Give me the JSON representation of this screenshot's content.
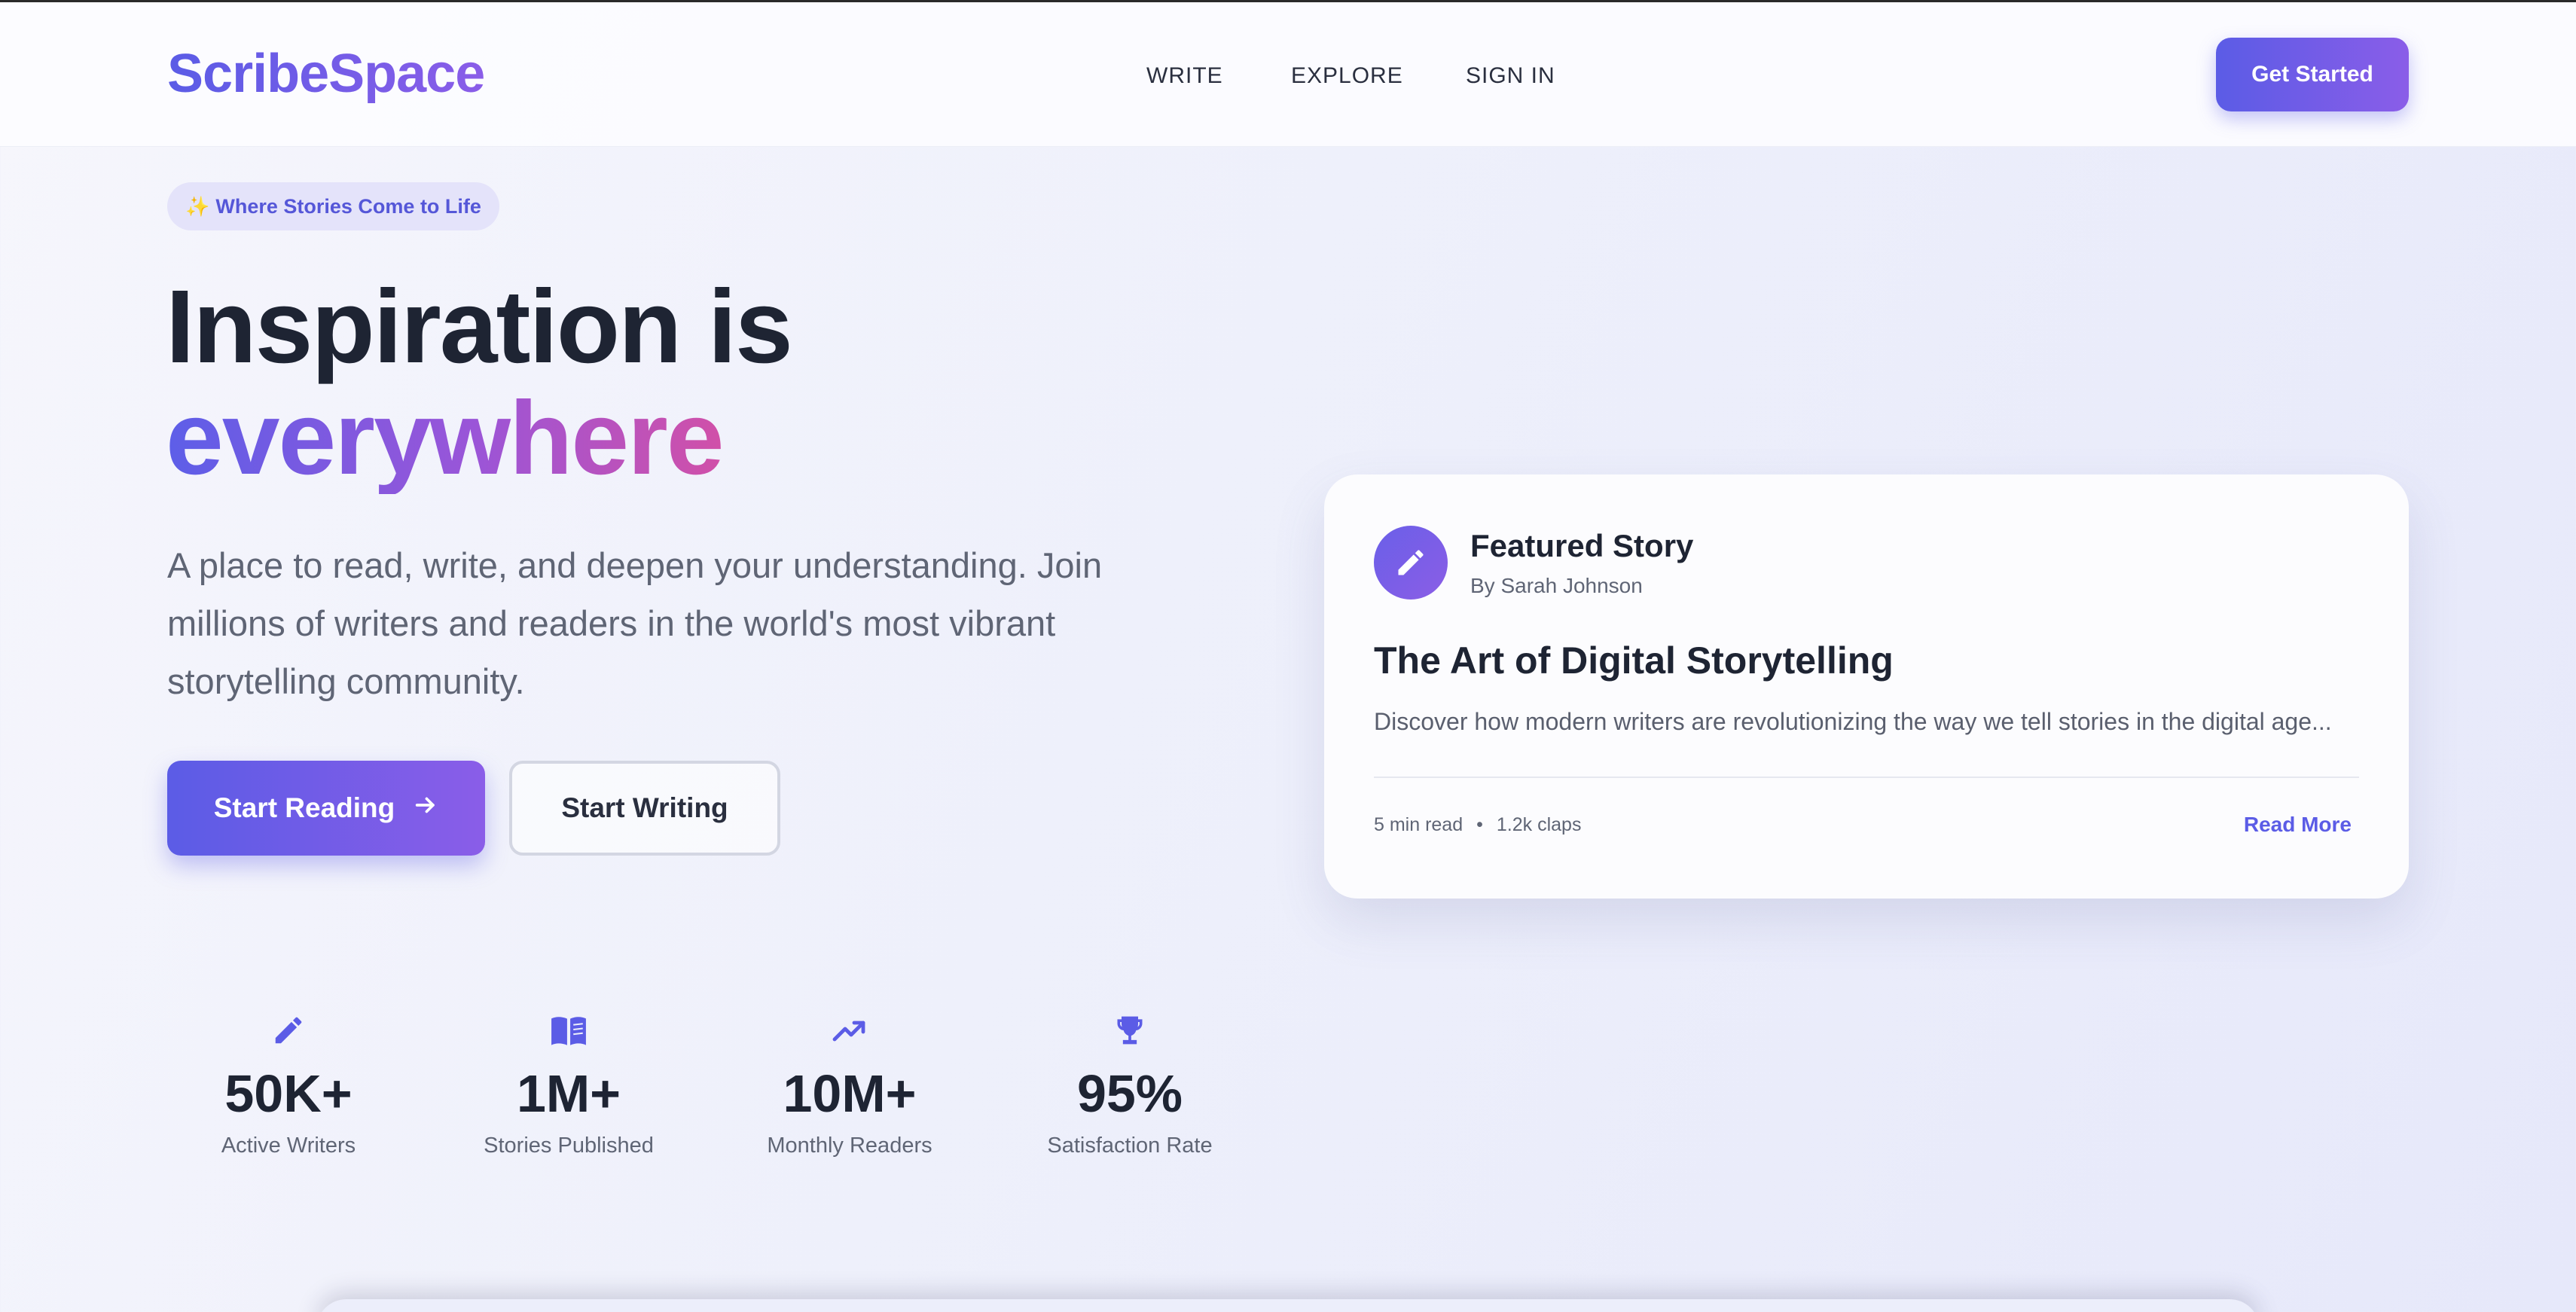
{
  "brand": {
    "name": "ScribeSpace",
    "accent": "#5b5ce6",
    "accent_end": "#8a5de8"
  },
  "nav": {
    "links": [
      {
        "label": "WRITE"
      },
      {
        "label": "EXPLORE"
      },
      {
        "label": "SIGN IN"
      }
    ],
    "cta_label": "Get Started"
  },
  "hero": {
    "badge": {
      "icon": "sparkle-icon",
      "text": "Where Stories Come to Life"
    },
    "headline_line1": "Inspiration is",
    "headline_line2": "everywhere",
    "description": "A place to read, write, and deepen your understanding. Join millions of writers and readers in the world's most vibrant storytelling community.",
    "primary_button": {
      "label": "Start Reading",
      "icon": "arrow-right-icon"
    },
    "secondary_button": {
      "label": "Start Writing"
    }
  },
  "featured": {
    "label": "Featured Story",
    "author": "By Sarah Johnson",
    "avatar_icon": "pencil-icon",
    "title": "The Art of Digital Storytelling",
    "excerpt": "Discover how modern writers are revolutionizing the way we tell stories in the digital age...",
    "read_time": "5 min read",
    "separator": "•",
    "claps": "1.2k claps",
    "read_more": "Read More"
  },
  "stats": [
    {
      "icon": "pencil-icon",
      "value": "50K+",
      "label": "Active Writers"
    },
    {
      "icon": "book-icon",
      "value": "1M+",
      "label": "Stories Published"
    },
    {
      "icon": "trending-up-icon",
      "value": "10M+",
      "label": "Monthly Readers"
    },
    {
      "icon": "trophy-icon",
      "value": "95%",
      "label": "Satisfaction Rate"
    }
  ]
}
